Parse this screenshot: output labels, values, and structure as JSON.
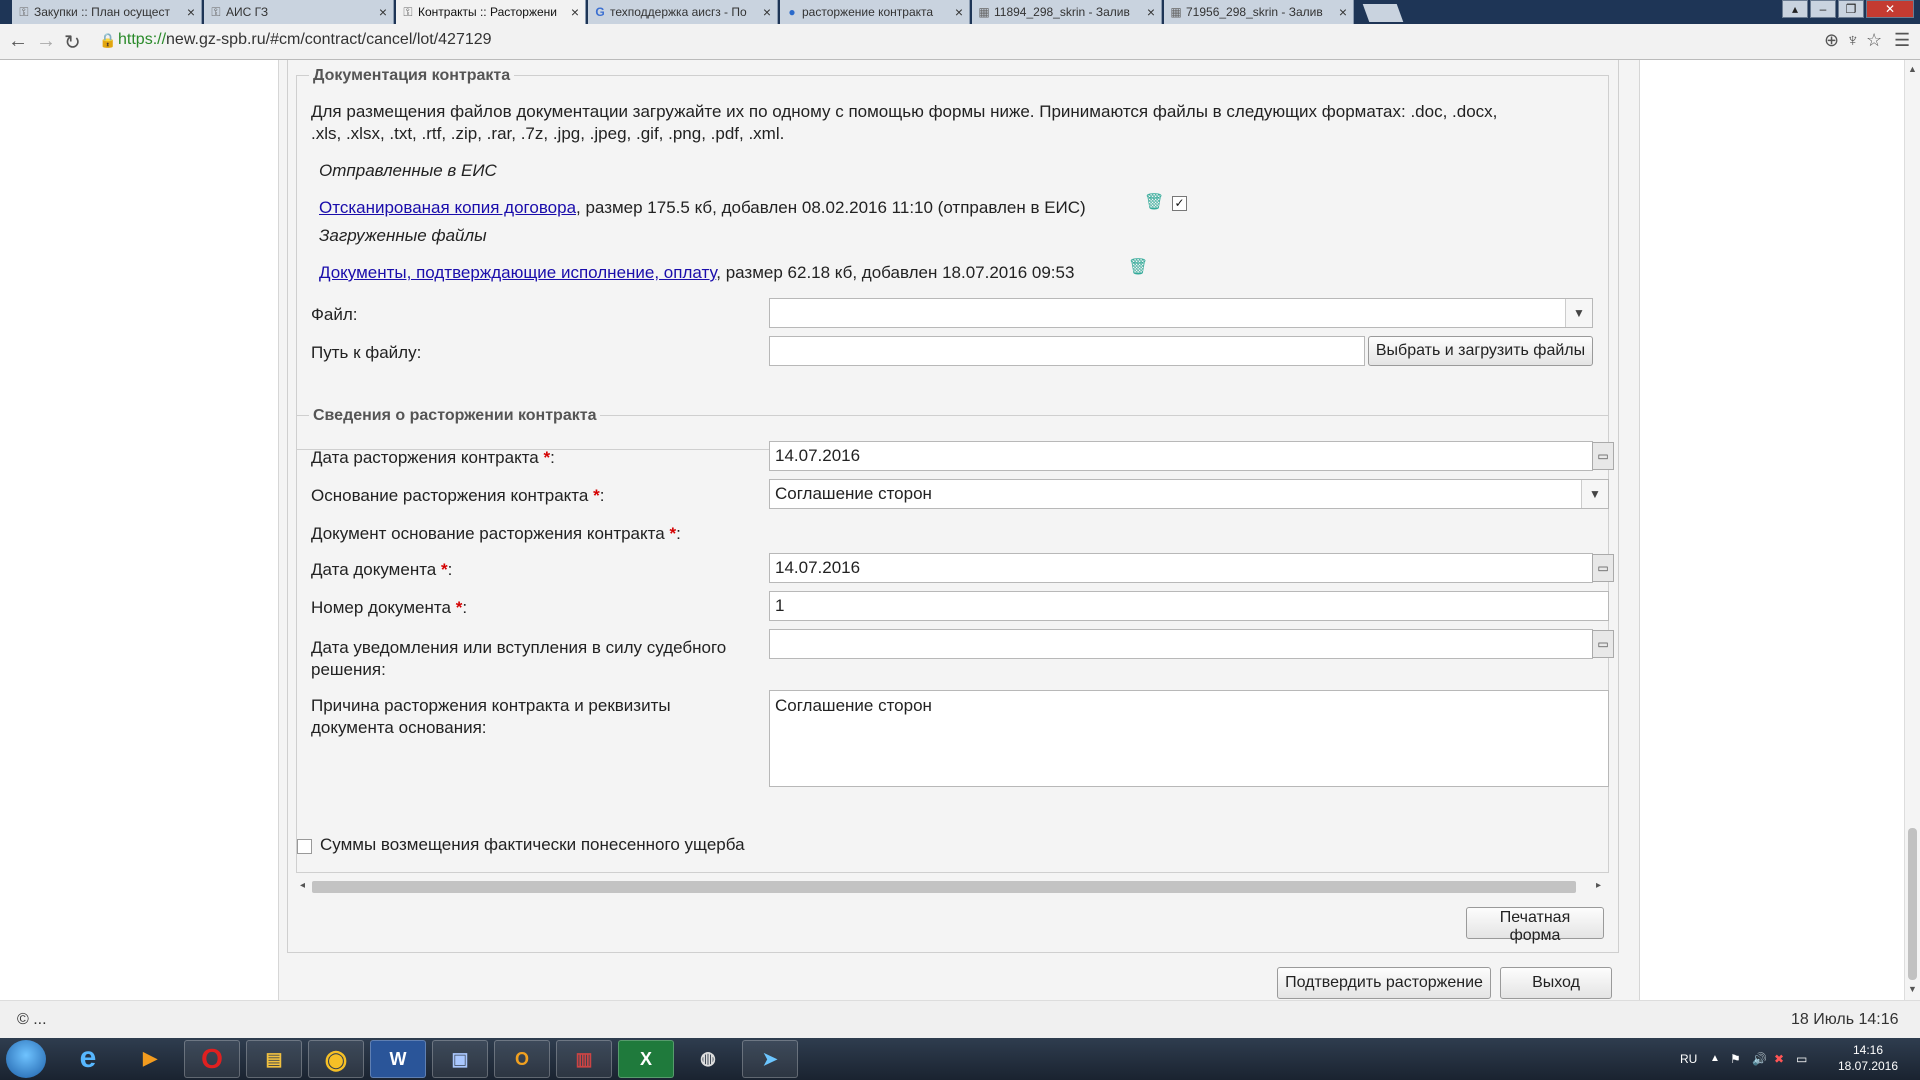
{
  "browser": {
    "tabs": [
      {
        "label": "Закупки :: План осущест",
        "icon": "key-icon",
        "active": false
      },
      {
        "label": "АИС ГЗ",
        "icon": "key-icon",
        "active": false
      },
      {
        "label": "Контракты :: Расторжени",
        "icon": "key-icon",
        "active": true
      },
      {
        "label": "техподдержка аисгз - По",
        "icon": "google-icon",
        "active": false
      },
      {
        "label": "расторжение контракта",
        "icon": "globe-icon",
        "active": false
      },
      {
        "label": "11894_298_skrin - Залив",
        "icon": "image-icon",
        "active": false
      },
      {
        "label": "71956_298_skrin - Залив",
        "icon": "image-icon",
        "active": false
      }
    ],
    "url_scheme": "https://",
    "url_rest": "new.gz-spb.ru/#cm/contract/cancel/lot/427129"
  },
  "docs": {
    "legend": "Документация контракта",
    "intro_line1": "Для размещения файлов документации загружайте их по одному с помощью формы ниже. Принимаются файлы в следующих форматах: .doc, .docx,",
    "intro_line2": ".xls, .xlsx, .txt, .rtf, .zip, .rar, .7z, .jpg, .jpeg, .gif, .png, .pdf, .xml.",
    "sent_heading": "Отправленные в ЕИС",
    "sent_file_link": "Отсканированая копия договора",
    "sent_file_meta": ", размер 175.5 кб, добавлен 08.02.2016 11:10 (отправлен в ЕИС)",
    "uploaded_heading": "Загруженные файлы",
    "uploaded_file_link": "Документы, подтверждающие исполнение, оплату",
    "uploaded_file_meta": ", размер 62.18 кб, добавлен 18.07.2016 09:53",
    "file_label": "Файл:",
    "file_value": "",
    "path_label": "Путь к файлу:",
    "path_value": "",
    "upload_button": "Выбрать и загрузить файлы"
  },
  "cancel": {
    "legend": "Сведения о расторжении контракта",
    "date_label": "Дата расторжения контракта",
    "date_value": "14.07.2016",
    "reason_label": "Основание расторжения контракта",
    "reason_value": "Соглашение сторон",
    "doc_basis_label": "Документ основание расторжения контракта",
    "doc_date_label": "Дата документа",
    "doc_date_value": "14.07.2016",
    "doc_number_label": "Номер документа",
    "doc_number_value": "1",
    "court_label_line1": "Дата уведомления или вступления в силу судебного",
    "court_label_line2": "решения:",
    "court_value": "",
    "cause_label_line1": "Причина расторжения контракта и реквизиты",
    "cause_label_line2": "документа основания:",
    "cause_value": "Соглашение сторон",
    "required_mark": "*",
    "colon": ":"
  },
  "damages_checkbox_label": "Суммы возмещения фактически понесенного ущерба",
  "buttons": {
    "print": "Печатная форма",
    "confirm": "Подтвердить расторжение",
    "exit": "Выход"
  },
  "footer": {
    "copyright": "© ...",
    "datetime": "18 Июль 14:16"
  },
  "taskbar": {
    "apps": [
      "ie-icon",
      "media-player-icon",
      "opera-icon",
      "explorer-icon",
      "chrome-icon",
      "word-icon",
      "network-icon",
      "outlook-icon",
      "winrar-icon",
      "excel-icon",
      "paint-icon",
      "telegram-icon"
    ],
    "lang": "RU",
    "clock_time": "14:16",
    "clock_date": "18.07.2016"
  }
}
